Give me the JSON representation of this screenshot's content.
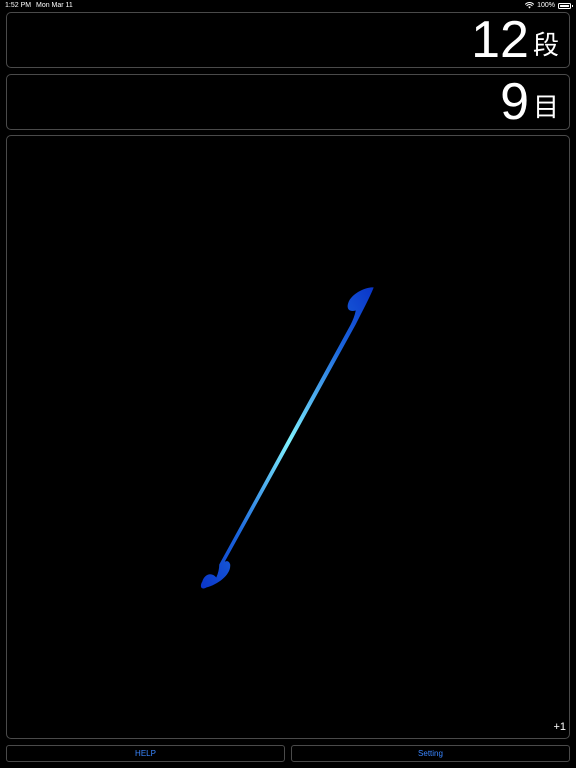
{
  "status_bar": {
    "time": "1:52 PM",
    "date": "Mon Mar 11",
    "battery": "100%"
  },
  "rows_counter": {
    "value": "12",
    "unit": "段"
  },
  "stitches_counter": {
    "value": "9",
    "unit": "目"
  },
  "main": {
    "increment_label": "+1",
    "hook_icon": "crochet-hook-icon"
  },
  "buttons": {
    "help_label": "HELP",
    "setting_label": "Setting"
  },
  "colors": {
    "accent": "#3a86ff",
    "hook_dark": "#0a35c8",
    "hook_light": "#7ff2ff",
    "border": "#4a4a4a",
    "background": "#000000"
  }
}
